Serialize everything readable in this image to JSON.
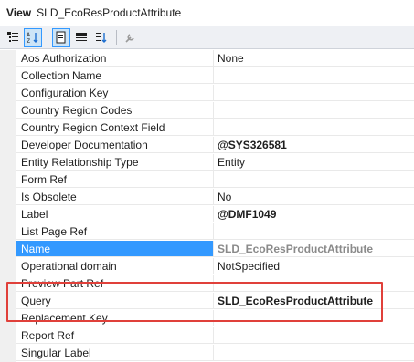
{
  "header": {
    "kind": "View",
    "name": "SLD_EcoResProductAttribute"
  },
  "toolbar": {
    "buttons": [
      "categorized-icon",
      "alphabetical-sort-icon",
      "property-pages-icon",
      "events-icon",
      "sort-order-icon",
      "wrench-icon"
    ]
  },
  "properties": [
    {
      "label": "Aos Authorization",
      "value": "None"
    },
    {
      "label": "Collection Name",
      "value": ""
    },
    {
      "label": "Configuration Key",
      "value": ""
    },
    {
      "label": "Country Region Codes",
      "value": ""
    },
    {
      "label": "Country Region Context Field",
      "value": ""
    },
    {
      "label": "Developer Documentation",
      "value": "@SYS326581"
    },
    {
      "label": "Entity Relationship Type",
      "value": "Entity"
    },
    {
      "label": "Form Ref",
      "value": ""
    },
    {
      "label": "Is Obsolete",
      "value": "No"
    },
    {
      "label": "Label",
      "value": "@DMF1049"
    },
    {
      "label": "List Page Ref",
      "value": ""
    },
    {
      "label": "Name",
      "value": "SLD_EcoResProductAttribute"
    },
    {
      "label": "Operational domain",
      "value": "NotSpecified"
    },
    {
      "label": "Preview Part Ref",
      "value": ""
    },
    {
      "label": "Query",
      "value": "SLD_EcoResProductAttribute"
    },
    {
      "label": "Replacement Key",
      "value": ""
    },
    {
      "label": "Report Ref",
      "value": ""
    },
    {
      "label": "Singular Label",
      "value": ""
    }
  ],
  "colors": {
    "selection": "#3399ff",
    "highlight_box": "#e0403a"
  }
}
